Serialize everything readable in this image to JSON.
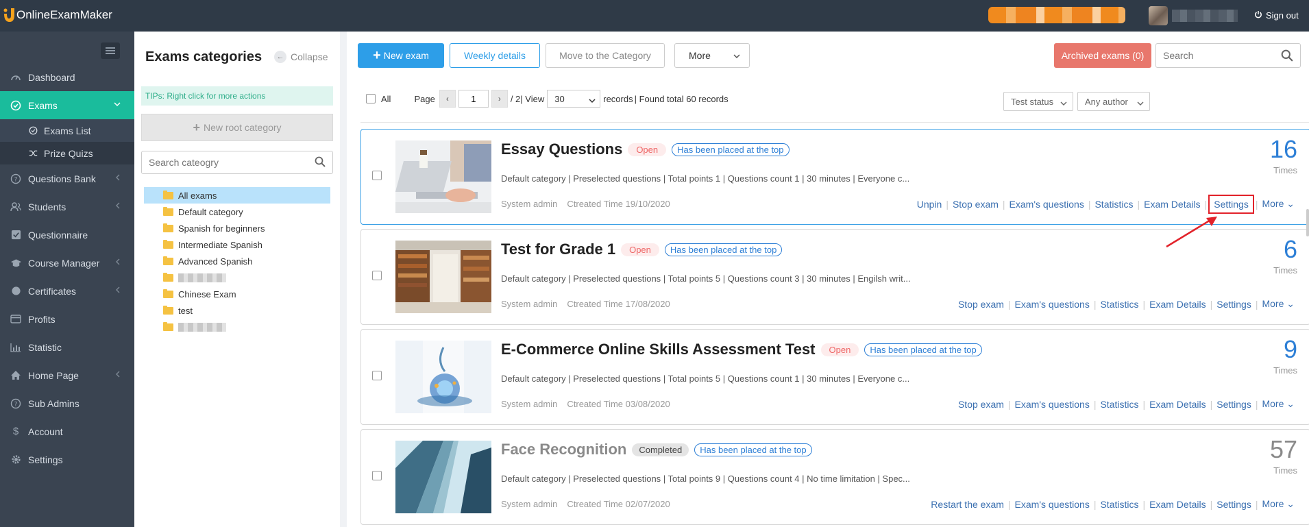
{
  "app": {
    "brand": "OnlineExamMaker",
    "signout": "Sign out"
  },
  "sidebar": {
    "items": [
      {
        "label": "Dashboard",
        "icon": "dashboard-icon",
        "arrow": false
      },
      {
        "label": "Exams",
        "icon": "check-circle-icon",
        "arrow": true,
        "active": true
      },
      {
        "label": "Questions Bank",
        "icon": "question-icon",
        "arrow": true
      },
      {
        "label": "Students",
        "icon": "users-icon",
        "arrow": true
      },
      {
        "label": "Questionnaire",
        "icon": "checkbox-icon",
        "arrow": false
      },
      {
        "label": "Course Manager",
        "icon": "graduation-cap-icon",
        "arrow": true
      },
      {
        "label": "Certificates",
        "icon": "certificate-icon",
        "arrow": true
      },
      {
        "label": "Profits",
        "icon": "card-icon",
        "arrow": false
      },
      {
        "label": "Statistic",
        "icon": "bar-chart-icon",
        "arrow": false
      },
      {
        "label": "Home Page",
        "icon": "home-icon",
        "arrow": true
      },
      {
        "label": "Sub Admins",
        "icon": "sub-admin-icon",
        "arrow": false
      },
      {
        "label": "Account",
        "icon": "dollar-icon",
        "arrow": false
      },
      {
        "label": "Settings",
        "icon": "gear-icon",
        "arrow": false
      }
    ],
    "sub_items": [
      {
        "label": "Exams List",
        "icon": "check-circle-icon"
      },
      {
        "label": "Prize Quizs",
        "icon": "shuffle-icon"
      }
    ]
  },
  "categories": {
    "title": "Exams categories",
    "collapse": "Collapse",
    "tips": "TIPs:  Right click for more actions",
    "new_root": "New root category",
    "search_placeholder": "Search cateogry",
    "tree": [
      "All exams",
      "Default category",
      "Spanish for beginners",
      "Intermediate Spanish",
      "Advanced Spanish",
      "",
      "Chinese Exam",
      "test",
      ""
    ]
  },
  "toolbar": {
    "new_exam": "New exam",
    "weekly": "Weekly details",
    "move": "Move to the Category",
    "more": "More",
    "archived": "Archived exams (0)",
    "search_placeholder": "Search"
  },
  "pager": {
    "all": "All",
    "page_label": "Page",
    "page": "1",
    "total_pages": "/ 2",
    "view_label": "| View",
    "view": "30",
    "records": "records",
    "found": "| Found total 60 records",
    "status_filter": "Test status",
    "author_filter": "Any author"
  },
  "exams": [
    {
      "title": "Essay Questions",
      "status": "Open",
      "status_kind": "open",
      "top": "Has been placed at the top",
      "desc": "Default category | Preselected questions | Total points 1 | Questions count 1 | 30 minutes | Everyone c...",
      "author": "System admin",
      "created": "Ctreated Time 19/10/2020",
      "count": "16",
      "times": "Times",
      "actions": [
        "Unpin",
        "Stop exam",
        "Exam's questions",
        "Statistics",
        "Exam Details",
        "Settings",
        "More"
      ]
    },
    {
      "title": "Test for Grade 1",
      "status": "Open",
      "status_kind": "open",
      "top": "Has been placed at the top",
      "desc": "Default category | Preselected questions | Total points 5 | Questions count 3 | 30 minutes | Engilsh writ...",
      "author": "System admin",
      "created": "Ctreated Time 17/08/2020",
      "count": "6",
      "times": "Times",
      "actions": [
        "Stop exam",
        "Exam's questions",
        "Statistics",
        "Exam Details",
        "Settings",
        "More"
      ]
    },
    {
      "title": "E-Commerce Online Skills Assessment Test",
      "status": "Open",
      "status_kind": "open",
      "top": "Has been placed at the top",
      "desc": "Default category | Preselected questions | Total points 5 | Questions count 1 | 30 minutes | Everyone c...",
      "author": "System admin",
      "created": "Ctreated Time 03/08/2020",
      "count": "9",
      "times": "Times",
      "actions": [
        "Stop exam",
        "Exam's questions",
        "Statistics",
        "Exam Details",
        "Settings",
        "More"
      ]
    },
    {
      "title": "Face Recognition",
      "status": "Completed",
      "status_kind": "done",
      "top": "Has been placed at the top",
      "desc": "Default category | Preselected questions | Total points 9 | Questions count 4 | No time limitation | Spec...",
      "author": "System admin",
      "created": "Ctreated Time 02/07/2020",
      "count": "57",
      "times": "Times",
      "actions": [
        "Restart the exam",
        "Exam's questions",
        "Statistics",
        "Exam Details",
        "Settings",
        "More"
      ]
    }
  ],
  "colors": {
    "accent": "#1abc9c",
    "primary": "#2d9ee8",
    "archived": "#e8776c",
    "highlight": "#e2222a"
  }
}
